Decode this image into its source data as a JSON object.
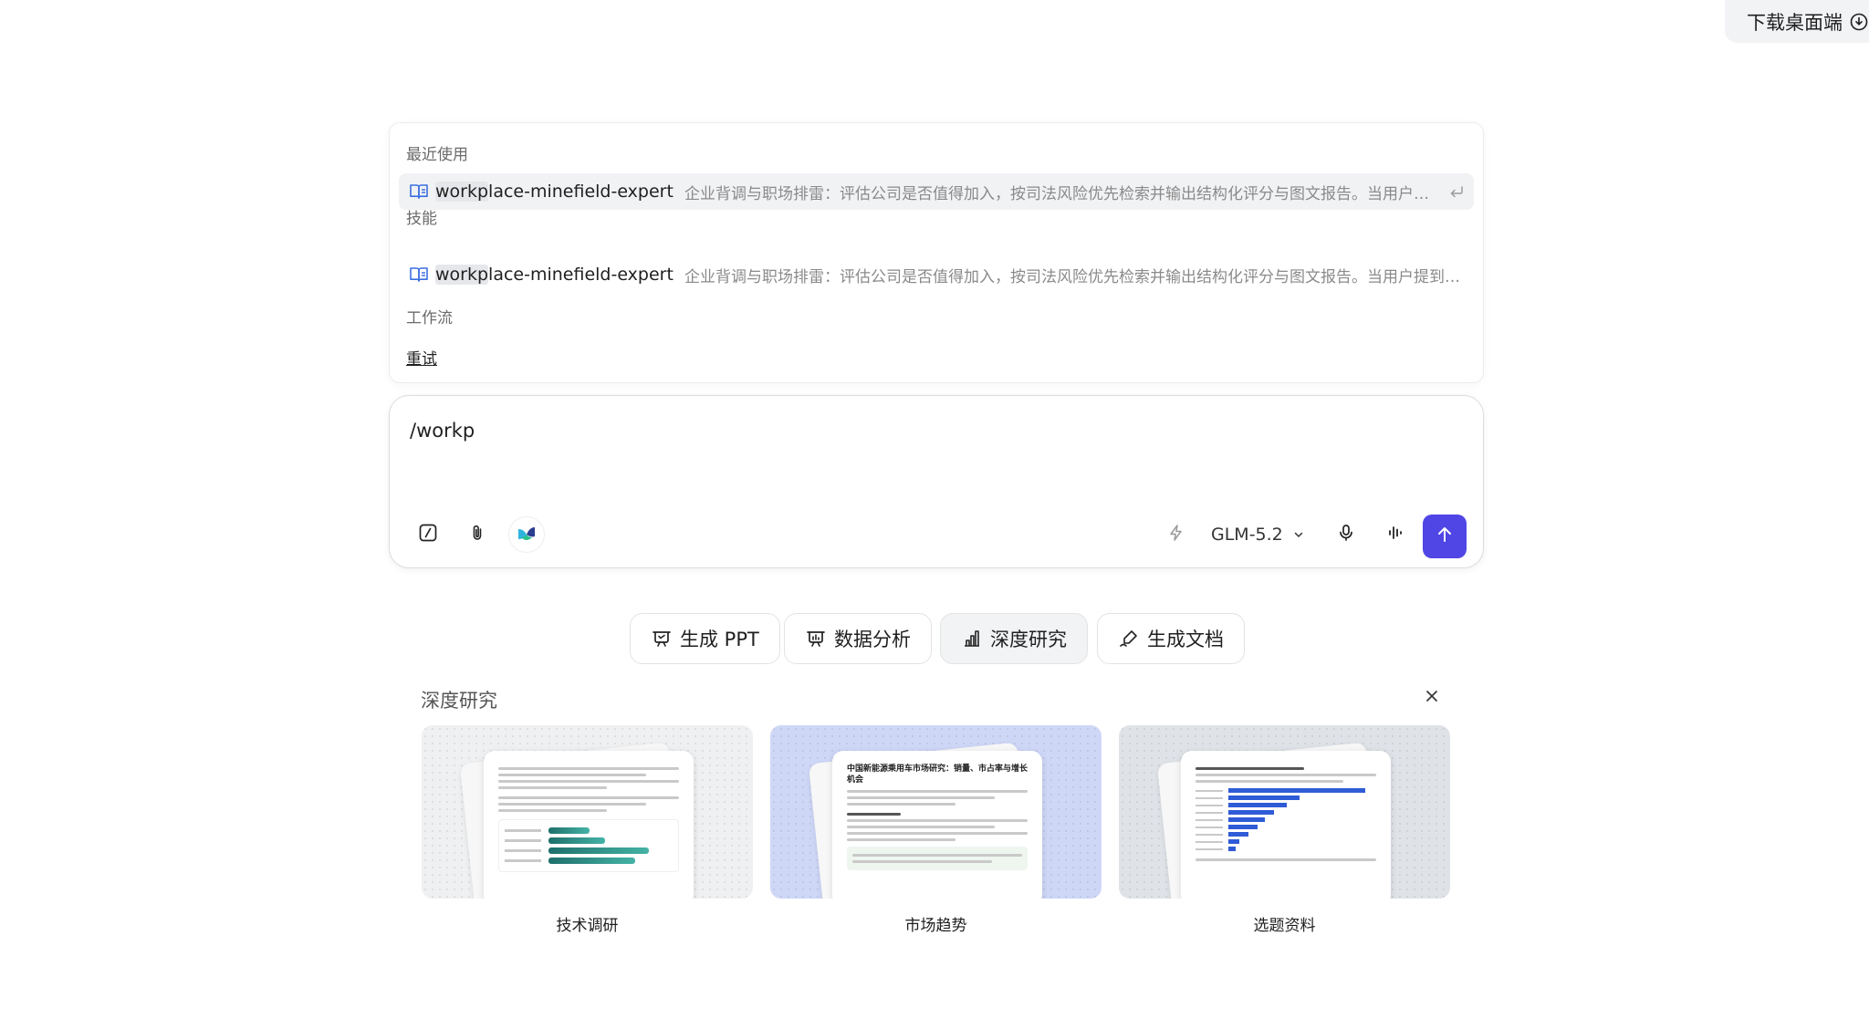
{
  "header": {
    "download_label": "下载桌面端",
    "download_icon": "download-circle-icon"
  },
  "dropdown": {
    "recent_heading": "最近使用",
    "skills_heading": "技能",
    "workflow_heading": "工作流",
    "retry_label": "重试",
    "items": [
      {
        "name_prefix": "workp",
        "name_suffix": "lace-minefield-expert",
        "description": "企业背调与职场排雷：评估公司是否值得加入，按司法风险优先检索并输出结构化评分与图文报告。当用户提到背调、公司风险、职场排雷等",
        "icon": "book-icon",
        "selected": true
      },
      {
        "name_prefix": "workp",
        "name_suffix": "lace-minefield-expert",
        "description": "企业背调与职场排雷：评估公司是否值得加入，按司法风险优先检索并输出结构化评分与图文报告。当用户提到背调、公司风险、职场排雷等",
        "icon": "book-icon",
        "selected": false
      }
    ]
  },
  "composer": {
    "input_value": "/workp",
    "model_label": "GLM-5.2",
    "tools": [
      "slash-command-icon",
      "paperclip-icon",
      "app-logo-icon"
    ],
    "right_tools": [
      "lightning-icon",
      "microphone-icon",
      "voice-wave-icon"
    ],
    "send_icon": "arrow-up-icon",
    "accent_color": "#5046e5"
  },
  "quick_actions": [
    {
      "label": "生成 PPT",
      "icon": "presentation-icon",
      "active": false
    },
    {
      "label": "数据分析",
      "icon": "chart-board-icon",
      "active": false
    },
    {
      "label": "深度研究",
      "icon": "bar-chart-icon",
      "active": true
    },
    {
      "label": "生成文档",
      "icon": "pen-icon",
      "active": false
    }
  ],
  "research_panel": {
    "title": "深度研究",
    "cards": [
      {
        "label": "技术调研",
        "doc_title": "",
        "bg": "#eef0f2"
      },
      {
        "label": "市场趋势",
        "doc_title": "中国新能源乘用车市场研究：销量、市占率与增长机会",
        "bg": "#cfd7f7"
      },
      {
        "label": "选题资料",
        "doc_title": "",
        "bg": "#dfe3e8"
      }
    ]
  }
}
